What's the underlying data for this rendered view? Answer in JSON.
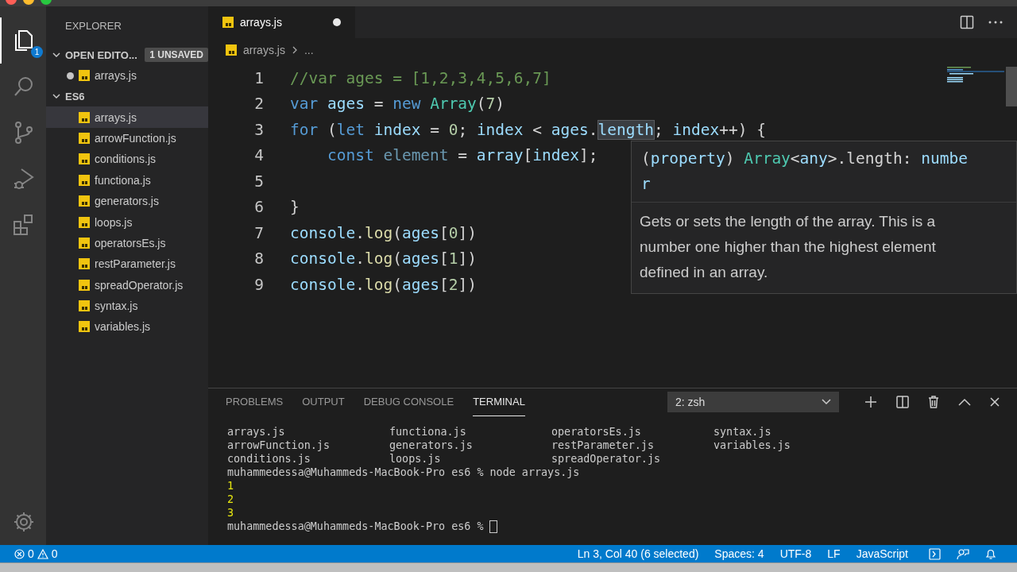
{
  "activity_bar": {
    "items": [
      {
        "kind": "files",
        "selected": true,
        "badge": "1"
      },
      {
        "kind": "search",
        "selected": false
      },
      {
        "kind": "branch",
        "selected": false
      },
      {
        "kind": "run",
        "selected": false
      },
      {
        "kind": "extensions",
        "selected": false
      }
    ]
  },
  "sidebar": {
    "title": "EXPLORER",
    "sections": [
      {
        "title": "OPEN EDITO...",
        "expanded": true,
        "badge": "1 UNSAVED",
        "files": [
          {
            "name": "arrays.js",
            "selected": false,
            "unsaved": true
          }
        ]
      },
      {
        "title": "ES6",
        "expanded": true,
        "files": [
          {
            "name": "arrays.js",
            "selected": true,
            "unsaved": false
          },
          {
            "name": "arrowFunction.js",
            "selected": false,
            "unsaved": false
          },
          {
            "name": "conditions.js",
            "selected": false,
            "unsaved": false
          },
          {
            "name": "functiona.js",
            "selected": false,
            "unsaved": false
          },
          {
            "name": "generators.js",
            "selected": false,
            "unsaved": false
          },
          {
            "name": "loops.js",
            "selected": false,
            "unsaved": false
          },
          {
            "name": "operatorsEs.js",
            "selected": false,
            "unsaved": false
          },
          {
            "name": "restParameter.js",
            "selected": false,
            "unsaved": false
          },
          {
            "name": "spreadOperator.js",
            "selected": false,
            "unsaved": false
          },
          {
            "name": "syntax.js",
            "selected": false,
            "unsaved": false
          },
          {
            "name": "variables.js",
            "selected": false,
            "unsaved": false
          }
        ]
      }
    ]
  },
  "editor": {
    "tabs": [
      {
        "label": "arrays.js",
        "selected": true,
        "unsaved": true
      }
    ],
    "breadcrumb": {
      "file": "arrays.js",
      "rest": "..."
    },
    "lines": [
      {
        "number": "1",
        "tokens": [
          {
            "text": "//var ages = [1,2,3,4,5,6,7]",
            "kind": "comment"
          }
        ]
      },
      {
        "number": "2",
        "tokens": [
          {
            "text": "var",
            "kind": "keyword"
          },
          {
            "text": " ages",
            "kind": "variable"
          },
          {
            "text": " = ",
            "kind": "plain"
          },
          {
            "text": "new",
            "kind": "keyword"
          },
          {
            "text": " Array",
            "kind": "class"
          },
          {
            "text": "(",
            "kind": "plain"
          },
          {
            "text": "7",
            "kind": "number"
          },
          {
            "text": ")",
            "kind": "plain"
          }
        ]
      },
      {
        "number": "3",
        "tokens": [
          {
            "text": "for",
            "kind": "keyword"
          },
          {
            "text": " (",
            "kind": "plain"
          },
          {
            "text": "let",
            "kind": "keyword"
          },
          {
            "text": " index",
            "kind": "variable"
          },
          {
            "text": " = ",
            "kind": "plain"
          },
          {
            "text": "0",
            "kind": "number"
          },
          {
            "text": "; ",
            "kind": "plain"
          },
          {
            "text": "index",
            "kind": "variable"
          },
          {
            "text": " < ",
            "kind": "plain"
          },
          {
            "text": "ages",
            "kind": "variable"
          },
          {
            "text": ".",
            "kind": "plain"
          },
          {
            "text": "length",
            "kind": "selection"
          },
          {
            "text": "; ",
            "kind": "plain"
          },
          {
            "text": "index",
            "kind": "variable"
          },
          {
            "text": "++) {",
            "kind": "plain"
          }
        ]
      },
      {
        "number": "4",
        "tokens": [
          {
            "text": "    const",
            "kind": "keyword"
          },
          {
            "text": " element",
            "kind": "unused"
          },
          {
            "text": " = ",
            "kind": "plain"
          },
          {
            "text": "array",
            "kind": "variable"
          },
          {
            "text": "[",
            "kind": "plain"
          },
          {
            "text": "index",
            "kind": "variable"
          },
          {
            "text": "];",
            "kind": "plain"
          }
        ]
      },
      {
        "number": "5"
      },
      {
        "number": "6",
        "tokens": [
          {
            "text": "}",
            "kind": "plain"
          }
        ]
      },
      {
        "number": "7",
        "tokens": [
          {
            "text": "console",
            "kind": "variable"
          },
          {
            "text": ".",
            "kind": "plain"
          },
          {
            "text": "log",
            "kind": "function"
          },
          {
            "text": "(",
            "kind": "plain"
          },
          {
            "text": "ages",
            "kind": "variable"
          },
          {
            "text": "[",
            "kind": "plain"
          },
          {
            "text": "0",
            "kind": "number"
          },
          {
            "text": "])",
            "kind": "plain"
          }
        ]
      },
      {
        "number": "8",
        "tokens": [
          {
            "text": "console",
            "kind": "variable"
          },
          {
            "text": ".",
            "kind": "plain"
          },
          {
            "text": "log",
            "kind": "function"
          },
          {
            "text": "(",
            "kind": "plain"
          },
          {
            "text": "ages",
            "kind": "variable"
          },
          {
            "text": "[",
            "kind": "plain"
          },
          {
            "text": "1",
            "kind": "number"
          },
          {
            "text": "])",
            "kind": "plain"
          }
        ]
      },
      {
        "number": "9",
        "tokens": [
          {
            "text": "console",
            "kind": "variable"
          },
          {
            "text": ".",
            "kind": "plain"
          },
          {
            "text": "log",
            "kind": "function"
          },
          {
            "text": "(",
            "kind": "plain"
          },
          {
            "text": "ages",
            "kind": "variable"
          },
          {
            "text": "[",
            "kind": "plain"
          },
          {
            "text": "2",
            "kind": "number"
          },
          {
            "text": "])",
            "kind": "plain"
          }
        ]
      }
    ],
    "hover": {
      "signature": [
        [
          {
            "text": "(",
            "kind": "plain"
          },
          {
            "text": "property",
            "kind": "variable"
          },
          {
            "text": ") ",
            "kind": "plain"
          },
          {
            "text": "Array",
            "kind": "class"
          },
          {
            "text": "<",
            "kind": "plain"
          },
          {
            "text": "any",
            "kind": "variable"
          },
          {
            "text": ">.length: ",
            "kind": "plain"
          },
          {
            "text": "numbe",
            "kind": "variable"
          }
        ],
        [
          {
            "text": "r",
            "kind": "variable"
          }
        ]
      ],
      "doc": "Gets or sets the length of the array. This is a number one higher than the highest element defined in an array."
    }
  },
  "panel": {
    "tabs": [
      {
        "label": "PROBLEMS",
        "selected": false
      },
      {
        "label": "OUTPUT",
        "selected": false
      },
      {
        "label": "DEBUG CONSOLE",
        "selected": false
      },
      {
        "label": "TERMINAL",
        "selected": true
      }
    ],
    "terminal_select": "2: zsh",
    "terminal": [
      {
        "kind": "grid",
        "cells": [
          "arrays.js",
          "functiona.js",
          "operatorsEs.js",
          "syntax.js"
        ]
      },
      {
        "kind": "grid",
        "cells": [
          "arrowFunction.js",
          "generators.js",
          "restParameter.js",
          "variables.js"
        ]
      },
      {
        "kind": "grid",
        "cells": [
          "conditions.js",
          "loops.js",
          "spreadOperator.js"
        ]
      },
      {
        "kind": "prompt",
        "text": "muhammedessa@Muhammeds-MacBook-Pro es6 % node arrays.js",
        "cursor": false
      },
      {
        "kind": "output",
        "text": "1"
      },
      {
        "kind": "output",
        "text": "2"
      },
      {
        "kind": "output",
        "text": "3"
      },
      {
        "kind": "prompt",
        "text": "muhammedessa@Muhammeds-MacBook-Pro es6 %",
        "cursor": true
      }
    ]
  },
  "status_bar": {
    "errors": "0",
    "warnings": "0",
    "items": [
      "Ln 3, Col 40 (6 selected)",
      "Spaces: 4",
      "UTF-8",
      "LF",
      "JavaScript"
    ]
  }
}
